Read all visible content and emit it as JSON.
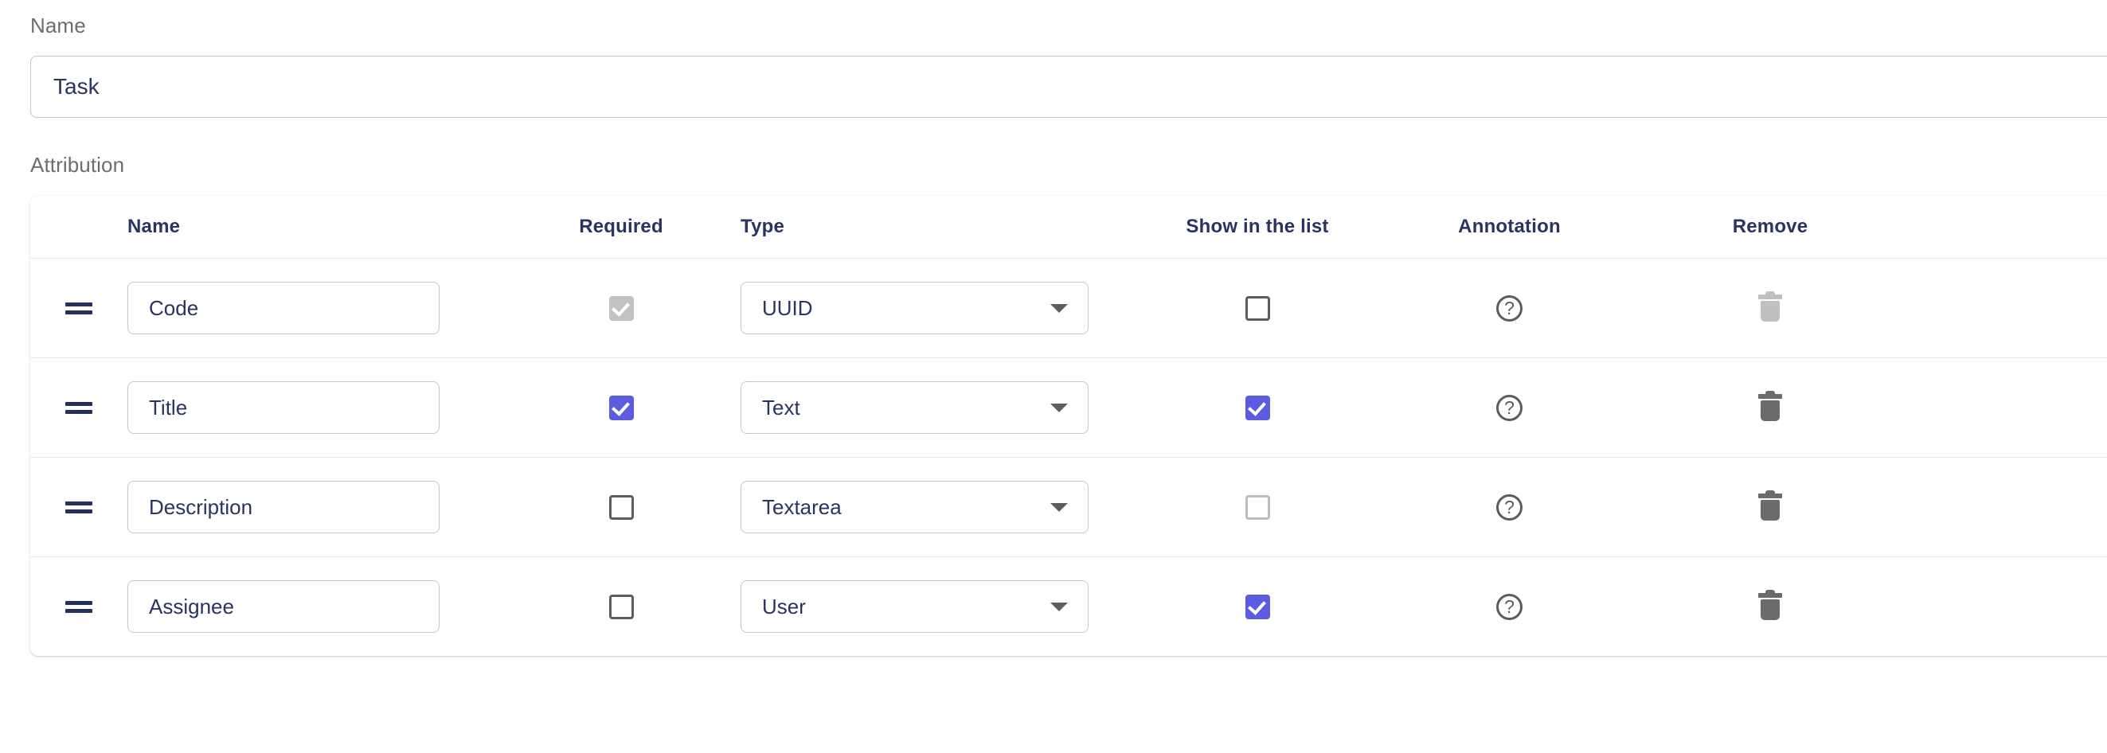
{
  "form": {
    "name_label": "Name",
    "name_value": "Task",
    "name_placeholder": "Name",
    "attribution_label": "Attribution"
  },
  "table": {
    "columns": {
      "handle": "",
      "name": "Name",
      "required": "Required",
      "type": "Type",
      "show_in_list": "Show in the list",
      "annotation": "Annotation",
      "remove": "Remove"
    },
    "rows": [
      {
        "name": "Code",
        "type": "UUID",
        "required_checked": true,
        "required_disabled": true,
        "show_checked": false,
        "show_disabled": false,
        "remove_disabled": true,
        "annotation_icon": "question-circle-icon",
        "remove_icon": "trash-icon",
        "handle_icon": "drag-handle-icon"
      },
      {
        "name": "Title",
        "type": "Text",
        "required_checked": true,
        "required_disabled": false,
        "show_checked": true,
        "show_disabled": false,
        "remove_disabled": false,
        "annotation_icon": "question-circle-icon",
        "remove_icon": "trash-icon",
        "handle_icon": "drag-handle-icon"
      },
      {
        "name": "Description",
        "type": "Textarea",
        "required_checked": false,
        "required_disabled": false,
        "show_checked": false,
        "show_disabled": true,
        "remove_disabled": false,
        "annotation_icon": "question-circle-icon",
        "remove_icon": "trash-icon",
        "handle_icon": "drag-handle-icon"
      },
      {
        "name": "Assignee",
        "type": "User",
        "required_checked": false,
        "required_disabled": false,
        "show_checked": true,
        "show_disabled": false,
        "remove_disabled": false,
        "annotation_icon": "question-circle-icon",
        "remove_icon": "trash-icon",
        "handle_icon": "drag-handle-icon"
      }
    ]
  },
  "icons": {
    "question_mark": "?"
  },
  "colors": {
    "accent": "#5c5ce0",
    "text": "#2b3360",
    "muted": "#6d6d6d",
    "border": "#c4c7ce",
    "divider": "#e6e6e6",
    "icon": "#5c5c5c",
    "disabled": "#c2c2c2"
  }
}
